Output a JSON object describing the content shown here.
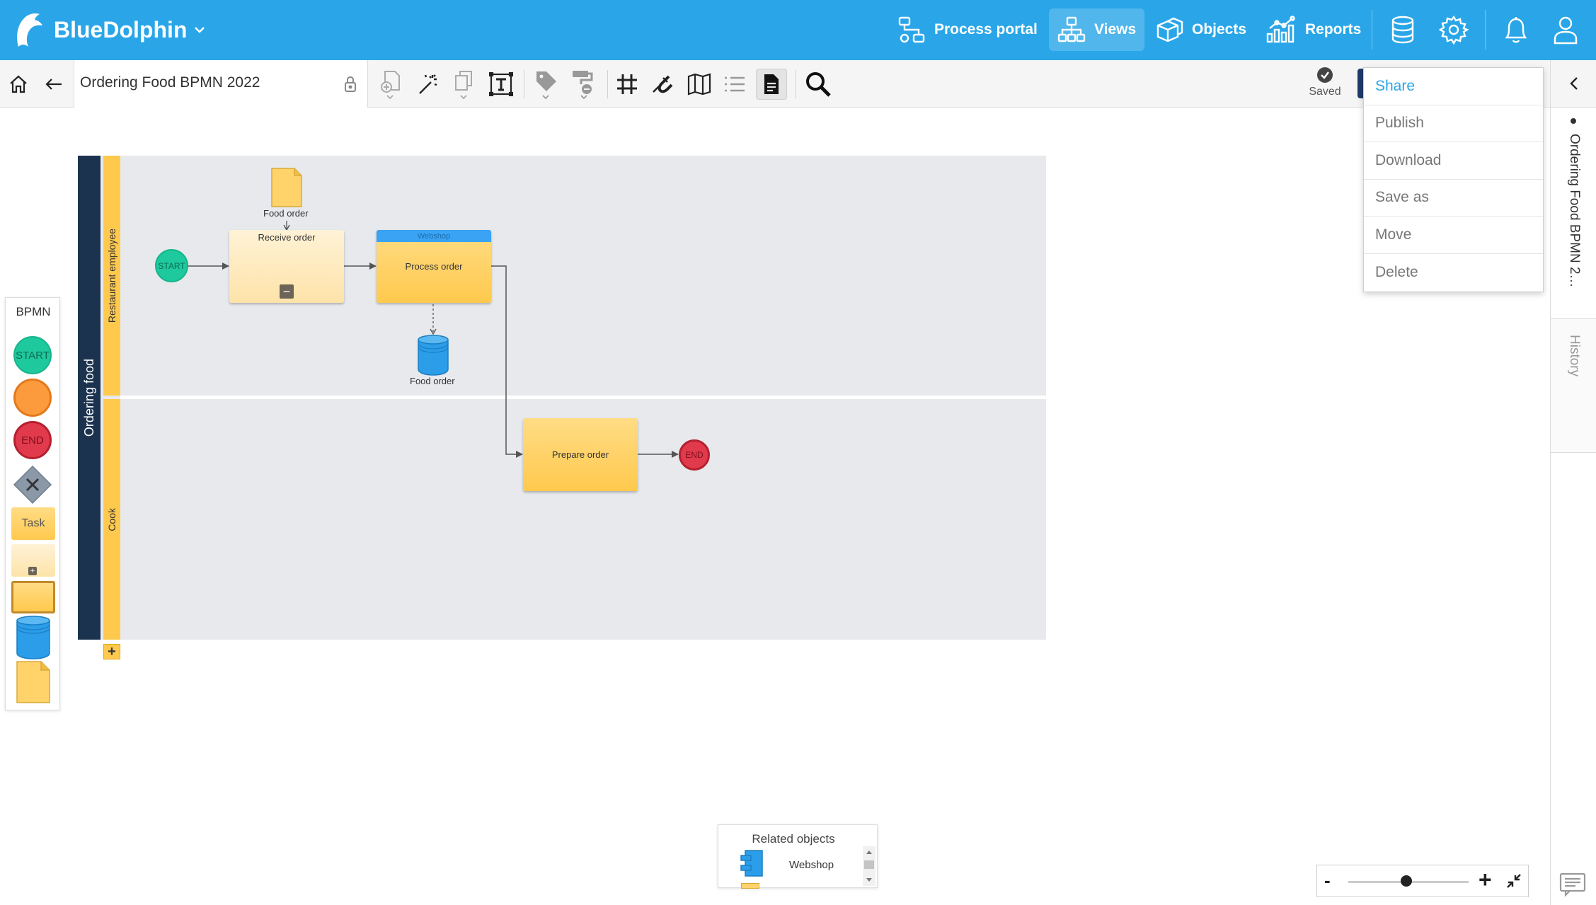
{
  "app": {
    "brand": "BlueDolphin",
    "accent": "#2aa6e8"
  },
  "nav": {
    "process_portal": "Process portal",
    "views": "Views",
    "objects": "Objects",
    "reports": "Reports"
  },
  "toolbar": {
    "view_title": "Ordering Food BPMN 2022",
    "saved": "Saved"
  },
  "menu": {
    "items": [
      "Share",
      "Publish",
      "Download",
      "Save as",
      "Move",
      "Delete"
    ]
  },
  "right_panel": {
    "view_tab": "Ordering Food BPMN 2…",
    "history_tab": "History"
  },
  "diagram": {
    "pool": "Ordering food",
    "lanes": [
      "Restaurant employee",
      "Cook"
    ],
    "start": "START",
    "end": "END",
    "document_label": "Food order",
    "task_receive": "Receive order",
    "task_process": "Process order",
    "task_process_band": "Webshop",
    "datastore_label": "Food order",
    "task_prepare": "Prepare order"
  },
  "palette": {
    "title": "BPMN",
    "start": "START",
    "end": "END",
    "task": "Task"
  },
  "related": {
    "title": "Related objects",
    "item": "Webshop"
  },
  "zoom": {
    "minus": "-",
    "plus": "+"
  }
}
